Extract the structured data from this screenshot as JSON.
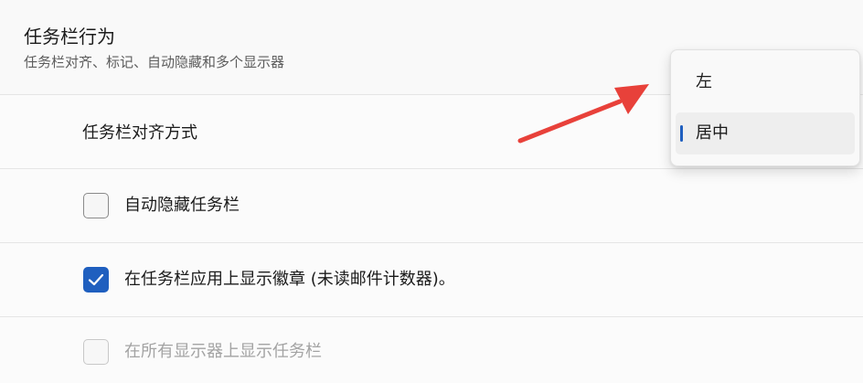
{
  "section": {
    "title": "任务栏行为",
    "subtitle": "任务栏对齐、标记、自动隐藏和多个显示器"
  },
  "alignment": {
    "label": "任务栏对齐方式"
  },
  "options": {
    "auto_hide": {
      "label": "自动隐藏任务栏",
      "checked": false
    },
    "badges": {
      "label": "在任务栏应用上显示徽章 (未读邮件计数器)。",
      "checked": true
    },
    "all_displays": {
      "label": "在所有显示器上显示任务栏",
      "checked": false,
      "disabled": true
    }
  },
  "dropdown": {
    "items": [
      {
        "label": "左",
        "selected": false
      },
      {
        "label": "居中",
        "selected": true
      }
    ]
  },
  "colors": {
    "accent": "#1f5fbf",
    "annotation_arrow": "#e8413a"
  }
}
